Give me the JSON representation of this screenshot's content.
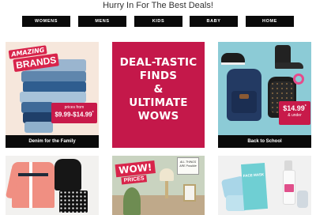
{
  "headline": "Hurry In For The Best Deals!",
  "nav": [
    "WOMENS",
    "MENS",
    "KIDS",
    "BABY",
    "HOME"
  ],
  "tiles": {
    "denim": {
      "badge_top": "AMAZING",
      "badge_bottom": "BRANDS",
      "price_from": "prices from",
      "price_range": "$9.99-$14.99",
      "price_sup": "*",
      "caption": "Denim for the Family"
    },
    "deals": {
      "line1": "DEAL-TASTIC",
      "line2": "FINDS",
      "line3": "&",
      "line4": "ULTIMATE",
      "line5": "WOWS"
    },
    "school": {
      "price": "$14.99",
      "price_sup": "*",
      "under": "& under",
      "caption": "Back to School"
    },
    "wow": {
      "wow": "WOW!",
      "prices": "PRICES",
      "sign_text": "ALL THINGS ARE Possible"
    },
    "masks": {
      "label": "FACE MASK"
    }
  },
  "colors": {
    "nav_bg": "#0a0a0a",
    "accent_red": "#c4184a",
    "school_bg": "#8ccbd6"
  }
}
